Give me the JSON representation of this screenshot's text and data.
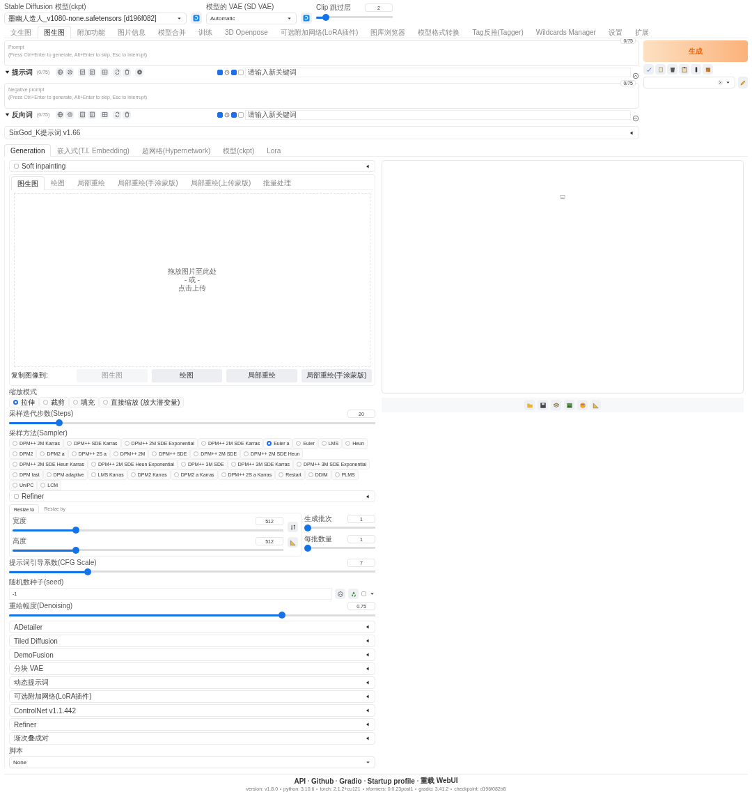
{
  "top_bar": {
    "checkpoint": {
      "label": "Stable Diffusion 模型(ckpt)",
      "value": "墨幽人造人_v1080-none.safetensors [d196f082]"
    },
    "vae": {
      "label": "模型的 VAE (SD VAE)",
      "value": "Automatic"
    },
    "clip_skip": {
      "label": "Clip 跳过层",
      "value": "2",
      "level": 0.09
    }
  },
  "main_tabs": [
    {
      "label": "文生图",
      "selected": false
    },
    {
      "label": "图生图",
      "selected": true
    },
    {
      "label": "附加功能",
      "selected": false
    },
    {
      "label": "图片信息",
      "selected": false
    },
    {
      "label": "模型合并",
      "selected": false
    },
    {
      "label": "训练",
      "selected": false
    },
    {
      "label": "3D Openpose",
      "selected": false
    },
    {
      "label": "可选附加网络(LoRA插件)",
      "selected": false
    },
    {
      "label": "图库浏览器",
      "selected": false
    },
    {
      "label": "模型格式转换",
      "selected": false
    },
    {
      "label": "Tag反推(Tagger)",
      "selected": false
    },
    {
      "label": "Wildcards Manager",
      "selected": false
    },
    {
      "label": "设置",
      "selected": false
    },
    {
      "label": "扩展",
      "selected": false
    }
  ],
  "prompts": [
    {
      "kind": "positive",
      "placeholder": "Prompt\n(Press Ctrl+Enter to generate, Alt+Enter to skip, Esc to interrupt)",
      "token_count": "0/75",
      "toolbar_label": "提示词",
      "toolbar_count": "(0/75)",
      "toggles": [
        {
          "kind": "checkbox",
          "checked": true
        },
        {
          "kind": "clock"
        },
        {
          "kind": "checkbox",
          "checked": true
        },
        {
          "kind": "checkbox",
          "checked": false
        }
      ],
      "keyword_placeholder": "请输入新关键词"
    },
    {
      "kind": "negative",
      "placeholder": "Negative prompt\n(Press Ctrl+Enter to generate, Alt+Enter to skip, Esc to interrupt)",
      "token_count": "0/75",
      "toolbar_label": "反向词",
      "toolbar_count": "(0/75)",
      "toggles": [
        {
          "kind": "checkbox",
          "checked": true
        },
        {
          "kind": "clock"
        },
        {
          "kind": "checkbox",
          "checked": true
        },
        {
          "kind": "checkbox",
          "checked": false
        }
      ],
      "keyword_placeholder": "请输入新关键词"
    }
  ],
  "extension_bar": {
    "title": "SixGod_K提示词 v1.66",
    "expanded": false
  },
  "generate_button": "生成",
  "sub_tabs": [
    {
      "label": "Generation",
      "selected": true
    },
    {
      "label": "嵌入式(T.I. Embedding)",
      "selected": false
    },
    {
      "label": "超网络(Hypernetwork)",
      "selected": false
    },
    {
      "label": "模型(ckpt)",
      "selected": false
    },
    {
      "label": "Lora",
      "selected": false
    }
  ],
  "soft_inpainting": {
    "label": "Soft inpainting",
    "checked": false,
    "expanded": false
  },
  "image_tabs": [
    {
      "label": "图生图",
      "selected": true
    },
    {
      "label": "绘图",
      "selected": false
    },
    {
      "label": "局部重绘",
      "selected": false
    },
    {
      "label": "局部重绘(手涂蒙版)",
      "selected": false
    },
    {
      "label": "局部重绘(上传蒙版)",
      "selected": false
    },
    {
      "label": "批量处理",
      "selected": false
    }
  ],
  "upload_area": {
    "lines": [
      "拖放图片至此处",
      "- 或 -",
      "点击上传"
    ]
  },
  "copy_to": {
    "label": "复制图像到:",
    "buttons": [
      {
        "label": "图生图",
        "disabled": true
      },
      {
        "label": "绘图",
        "disabled": false
      },
      {
        "label": "局部重绘",
        "disabled": false
      },
      {
        "label": "局部重绘(手涂蒙版)",
        "disabled": false
      }
    ]
  },
  "resize_mode": {
    "label": "缩放模式",
    "options": [
      {
        "label": "拉伸",
        "selected": true
      },
      {
        "label": "裁剪",
        "selected": false
      },
      {
        "label": "填充",
        "selected": false
      },
      {
        "label": "直接缩放 (放大潜变量)",
        "selected": false
      }
    ]
  },
  "steps": {
    "label": "采样迭代步数(Steps)",
    "value": "20",
    "level": 0.13
  },
  "sampler": {
    "label": "采样方法(Sampler)",
    "options": [
      {
        "label": "DPM++ 2M Karras",
        "selected": false
      },
      {
        "label": "DPM++ SDE Karras",
        "selected": false
      },
      {
        "label": "DPM++ 2M SDE Exponential",
        "selected": false
      },
      {
        "label": "DPM++ 2M SDE Karras",
        "selected": false
      },
      {
        "label": "Euler a",
        "selected": true
      },
      {
        "label": "Euler",
        "selected": false
      },
      {
        "label": "LMS",
        "selected": false
      },
      {
        "label": "Heun",
        "selected": false
      },
      {
        "label": "DPM2",
        "selected": false
      },
      {
        "label": "DPM2 a",
        "selected": false
      },
      {
        "label": "DPM++ 2S a",
        "selected": false
      },
      {
        "label": "DPM++ 2M",
        "selected": false
      },
      {
        "label": "DPM++ SDE",
        "selected": false
      },
      {
        "label": "DPM++ 2M SDE",
        "selected": false
      },
      {
        "label": "DPM++ 2M SDE Heun",
        "selected": false
      },
      {
        "label": "DPM++ 2M SDE Heun Karras",
        "selected": false
      },
      {
        "label": "DPM++ 2M SDE Heun Exponential",
        "selected": false
      },
      {
        "label": "DPM++ 3M SDE",
        "selected": false
      },
      {
        "label": "DPM++ 3M SDE Karras",
        "selected": false
      },
      {
        "label": "DPM++ 3M SDE Exponential",
        "selected": false
      },
      {
        "label": "DPM fast",
        "selected": false
      },
      {
        "label": "DPM adaptive",
        "selected": false
      },
      {
        "label": "LMS Karras",
        "selected": false
      },
      {
        "label": "DPM2 Karras",
        "selected": false
      },
      {
        "label": "DPM2 a Karras",
        "selected": false
      },
      {
        "label": "DPM++ 2S a Karras",
        "selected": false
      },
      {
        "label": "Restart",
        "selected": false
      },
      {
        "label": "DDIM",
        "selected": false
      },
      {
        "label": "PLMS",
        "selected": false
      },
      {
        "label": "UniPC",
        "selected": false
      },
      {
        "label": "LCM",
        "selected": false
      }
    ]
  },
  "refiner": {
    "label": "Refiner",
    "checked": false,
    "expanded": false
  },
  "resize": {
    "tabs": [
      {
        "label": "Resize to",
        "selected": true
      },
      {
        "label": "Resize by",
        "selected": false
      }
    ],
    "width": {
      "label": "宽度",
      "value": "512",
      "level": 0.226
    },
    "height": {
      "label": "高度",
      "value": "512",
      "level": 0.226
    },
    "batch_count": {
      "label": "生成批次",
      "value": "1",
      "level": 0
    },
    "batch_size": {
      "label": "每批数量",
      "value": "1",
      "level": 0
    }
  },
  "cfg": {
    "label": "提示词引导系数(CFG Scale)",
    "value": "7",
    "level": 0.21
  },
  "seed": {
    "label": "随机数种子(seed)",
    "value": "-1",
    "extra_checked": false
  },
  "denoising": {
    "label": "重绘幅度(Denoising)",
    "value": "0.75",
    "level": 0.75
  },
  "accordions": [
    {
      "title": "ADetailer",
      "expanded": false
    },
    {
      "title": "Tiled Diffusion",
      "expanded": false
    },
    {
      "title": "DemoFusion",
      "expanded": false
    },
    {
      "title": "分块 VAE",
      "expanded": false
    },
    {
      "title": "动态提示词",
      "expanded": false
    },
    {
      "title": "可选附加网络(LoRA插件)",
      "expanded": false
    },
    {
      "title": "ControlNet v1.1.442",
      "expanded": false
    },
    {
      "title": "Refiner",
      "expanded": false
    },
    {
      "title": "渐次叠成对",
      "expanded": false
    }
  ],
  "script": {
    "label": "脚本",
    "value": "None"
  },
  "footer": {
    "links": [
      "API",
      "Github",
      "Gradio",
      "Startup profile",
      "重载 WebUI"
    ],
    "versions": [
      "version: v1.8.0",
      "python: 3.10.6",
      "torch: 2.1.2+cu121",
      "xformers: 0.0.23post1",
      "gradio: 3.41.2",
      "checkpoint: d196f082b8"
    ]
  }
}
